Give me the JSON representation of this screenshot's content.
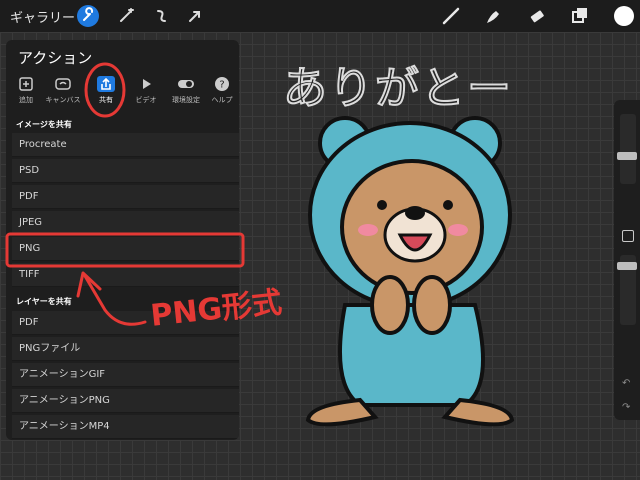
{
  "topbar": {
    "gallery_label": "ギャラリー",
    "left_icons": [
      "wrench-icon",
      "magic-wand-icon",
      "selection-icon",
      "move-arrow-icon"
    ],
    "right_icons": [
      "brush-icon",
      "smudge-icon",
      "eraser-icon",
      "layers-icon",
      "color-swatch"
    ],
    "accent": "#1f7ae0"
  },
  "panel": {
    "title": "アクション",
    "tabs": [
      {
        "label": "追加",
        "icon": "add-icon"
      },
      {
        "label": "キャンバス",
        "icon": "canvas-icon"
      },
      {
        "label": "共有",
        "icon": "share-icon",
        "active": true
      },
      {
        "label": "ビデオ",
        "icon": "video-icon"
      },
      {
        "label": "環境設定",
        "icon": "toggle-icon"
      },
      {
        "label": "ヘルプ",
        "icon": "help-icon"
      }
    ],
    "share_image_header": "イメージを共有",
    "share_image_items": [
      "Procreate",
      "PSD",
      "PDF",
      "JPEG",
      "PNG",
      "TIFF"
    ],
    "share_layers_header": "レイヤーを共有",
    "share_layers_items": [
      "PDF",
      "PNGファイル",
      "アニメーションGIF",
      "アニメーションPNG",
      "アニメーションMP4"
    ]
  },
  "canvas": {
    "handwritten_title": "ありがとー",
    "annotation_text": "PNG形式",
    "annotation_color": "#e53935"
  }
}
